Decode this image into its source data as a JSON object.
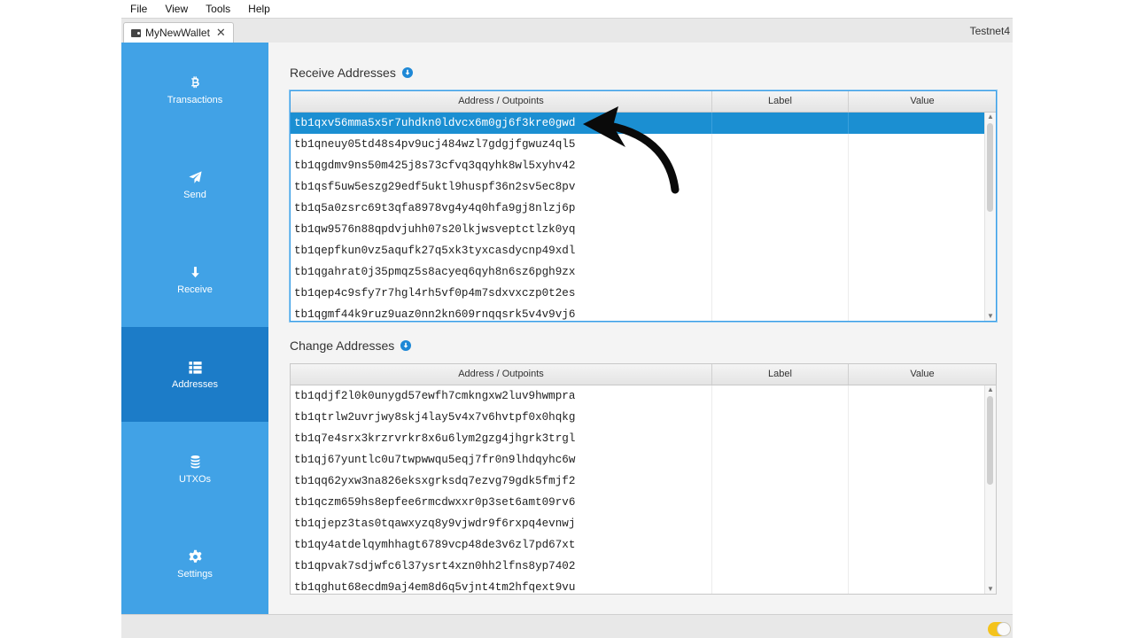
{
  "menu": [
    "File",
    "View",
    "Tools",
    "Help"
  ],
  "tab": {
    "label": "MyNewWallet",
    "close": "✕"
  },
  "network": "Testnet4",
  "sidebar": {
    "items": [
      {
        "label": "Transactions",
        "icon": "bitcoin-icon"
      },
      {
        "label": "Send",
        "icon": "send-icon"
      },
      {
        "label": "Receive",
        "icon": "arrow-down-icon"
      },
      {
        "label": "Addresses",
        "icon": "list-icon",
        "active": true
      },
      {
        "label": "UTXOs",
        "icon": "coins-icon"
      },
      {
        "label": "Settings",
        "icon": "gear-icon"
      }
    ]
  },
  "receive": {
    "title": "Receive Addresses",
    "columns": [
      "Address / Outpoints",
      "Label",
      "Value"
    ],
    "rows": [
      "tb1qxv56mma5x5r7uhdkn0ldvcx6m0gj6f3kre0gwd",
      "tb1qneuy05td48s4pv9ucj484wzl7gdgjfgwuz4ql5",
      "tb1qgdmv9ns50m425j8s73cfvq3qqyhk8wl5xyhv42",
      "tb1qsf5uw5eszg29edf5uktl9huspf36n2sv5ec8pv",
      "tb1q5a0zsrc69t3qfa8978vg4y4q0hfa9gj8nlzj6p",
      "tb1qw9576n88qpdvjuhh07s20lkjwsveptctlzk0yq",
      "tb1qepfkun0vz5aqufk27q5xk3tyxcasdycnp49xdl",
      "tb1qgahrat0j35pmqz5s8acyeq6qyh8n6sz6pgh9zx",
      "tb1qep4c9sfy7r7hgl4rh5vf0p4m7sdxvxczp0t2es",
      "tb1qgmf44k9ruz9uaz0nn2kn609rnqqsrk5v4v9vj6"
    ]
  },
  "change": {
    "title": "Change Addresses",
    "columns": [
      "Address / Outpoints",
      "Label",
      "Value"
    ],
    "rows": [
      "tb1qdjf2l0k0unygd57ewfh7cmkngxw2luv9hwmpra",
      "tb1qtrlw2uvrjwy8skj4lay5v4x7v6hvtpf0x0hqkg",
      "tb1q7e4srx3krzrvrkr8x6u6lym2gzg4jhgrk3trgl",
      "tb1qj67yuntlc0u7twpwwqu5eqj7fr0n9lhdqyhc6w",
      "tb1qq62yxw3na826eksxgrksdq7ezvg79gdk5fmjf2",
      "tb1qczm659hs8epfee6rmcdwxxr0p3set6amt09rv6",
      "tb1qjepz3tas0tqawxyzq8y9vjwdr9f6rxpq4evnwj",
      "tb1qy4atdelqymhhagt6789vcp48de3v6zl7pd67xt",
      "tb1qpvak7sdjwfc6l37ysrt4xzn0hh2lfns8yp7402",
      "tb1qghut68ecdm9aj4em8d6q5vjnt4tm2hfqext9vu"
    ]
  }
}
